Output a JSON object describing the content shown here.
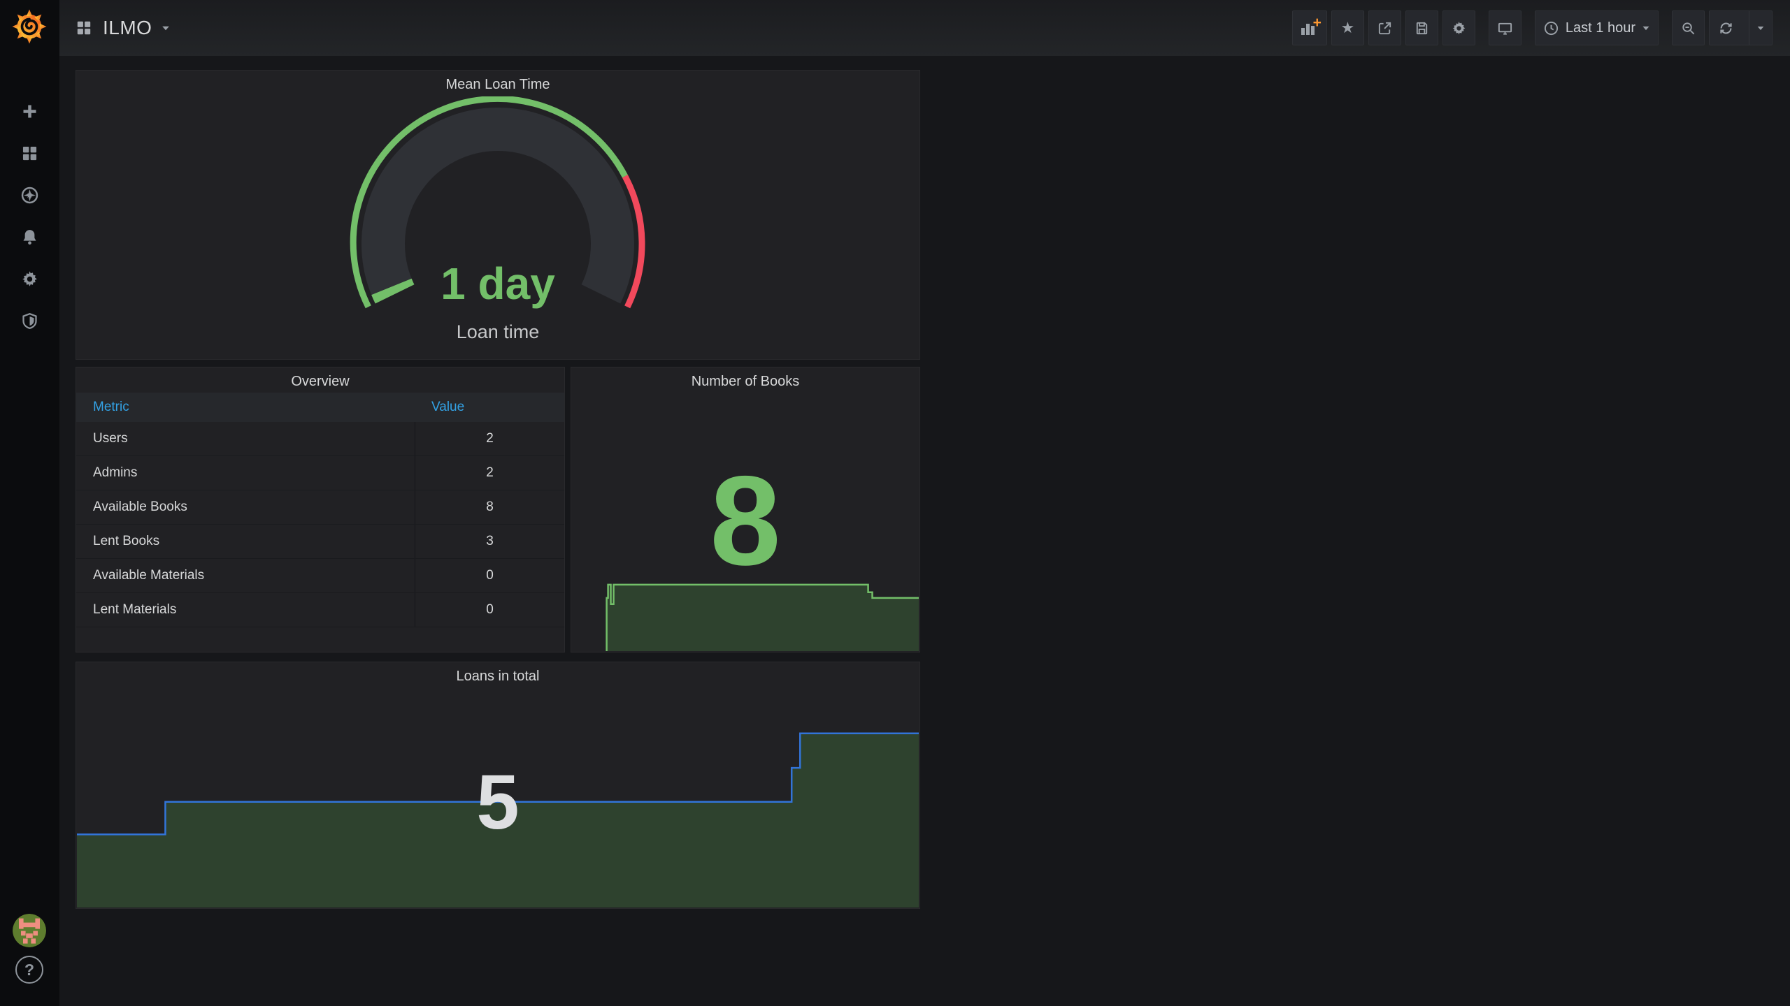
{
  "colors": {
    "green": "#73BF69",
    "red": "#F2495C",
    "blue": "#3274D9",
    "header_blue": "#33A2E5",
    "orange_plus": "#FF9830",
    "gauge_body": "#2F3136",
    "area_fill_green": "rgba(86,166,75,0.25)",
    "page_bg": "#16171A",
    "panel_bg": "#212124",
    "sidebar_bg": "#0B0C0E"
  },
  "sidebar": {
    "logo_icon": "grafana-logo",
    "items": [
      {
        "icon": "plus-icon"
      },
      {
        "icon": "dashboards-grid-icon"
      },
      {
        "icon": "explore-compass-icon"
      },
      {
        "icon": "alerting-bell-icon"
      },
      {
        "icon": "settings-gear-icon"
      },
      {
        "icon": "server-admin-shield-icon"
      }
    ],
    "avatar_icon": "user-avatar",
    "help_icon": "help-question-icon"
  },
  "topnav": {
    "dashboard_icon": "dashboard-grid-icon",
    "title": "ILMO",
    "toolbar": {
      "icons": [
        "add-panel-icon",
        "star-icon",
        "share-icon",
        "save-icon",
        "gear-icon",
        "tv-icon"
      ],
      "time_range_label": "Last 1 hour",
      "zoom_out_icon": "zoom-out-icon",
      "refresh_icon": "refresh-icon"
    }
  },
  "panels": {
    "gauge": {
      "title": "Mean Loan Time",
      "value": "1 day",
      "label": "Loan time"
    },
    "overview": {
      "title": "Overview",
      "columns": [
        "Metric",
        "Value"
      ],
      "rows": [
        [
          "Users",
          "2"
        ],
        [
          "Admins",
          "2"
        ],
        [
          "Available Books",
          "8"
        ],
        [
          "Lent Books",
          "3"
        ],
        [
          "Available Materials",
          "0"
        ],
        [
          "Lent Materials",
          "0"
        ]
      ]
    },
    "books": {
      "title": "Number of Books",
      "value": "8"
    },
    "loans": {
      "title": "Loans in total",
      "value": "5"
    }
  },
  "chart_data": [
    {
      "id": "mean-loan-time-gauge",
      "type": "gauge",
      "title": "Mean Loan Time",
      "value_text": "1 day",
      "field_label": "Loan time",
      "start_angle_deg": 206,
      "end_angle_deg": -26,
      "threshold_angle_deg": 28,
      "value_sweep_deg": 4,
      "segments": [
        {
          "color_key": "green",
          "approx_fraction": 0.77
        },
        {
          "color_key": "red",
          "approx_fraction": 0.23
        }
      ]
    },
    {
      "id": "number-of-books-spark",
      "type": "area",
      "title": "Number of Books",
      "current": 8,
      "approx_values": {
        "start": 8,
        "plateau": 9,
        "end": 8
      },
      "line_color_key": "green",
      "fill_color_key": "area_fill_green",
      "points": [
        [
          0.1,
          1.0
        ],
        [
          0.1,
          0.812
        ],
        [
          0.104,
          0.812
        ],
        [
          0.104,
          0.765
        ],
        [
          0.112,
          0.765
        ],
        [
          0.112,
          0.834
        ],
        [
          0.12,
          0.834
        ],
        [
          0.12,
          0.765
        ],
        [
          0.854,
          0.765
        ],
        [
          0.854,
          0.792
        ],
        [
          0.866,
          0.792
        ],
        [
          0.866,
          0.812
        ],
        [
          1.0,
          0.812
        ]
      ]
    },
    {
      "id": "loans-in-total-steps",
      "type": "area",
      "title": "Loans in total",
      "current": 5,
      "approx_values": {
        "start": 3,
        "middle": 4,
        "end": 5
      },
      "line_color_key": "blue",
      "fill_color_key": "area_fill_green",
      "points": [
        [
          0.0,
          0.701
        ],
        [
          0.105,
          0.701
        ],
        [
          0.105,
          0.568
        ],
        [
          0.849,
          0.568
        ],
        [
          0.849,
          0.429
        ],
        [
          0.859,
          0.429
        ],
        [
          0.859,
          0.288
        ],
        [
          1.0,
          0.288
        ]
      ]
    }
  ]
}
